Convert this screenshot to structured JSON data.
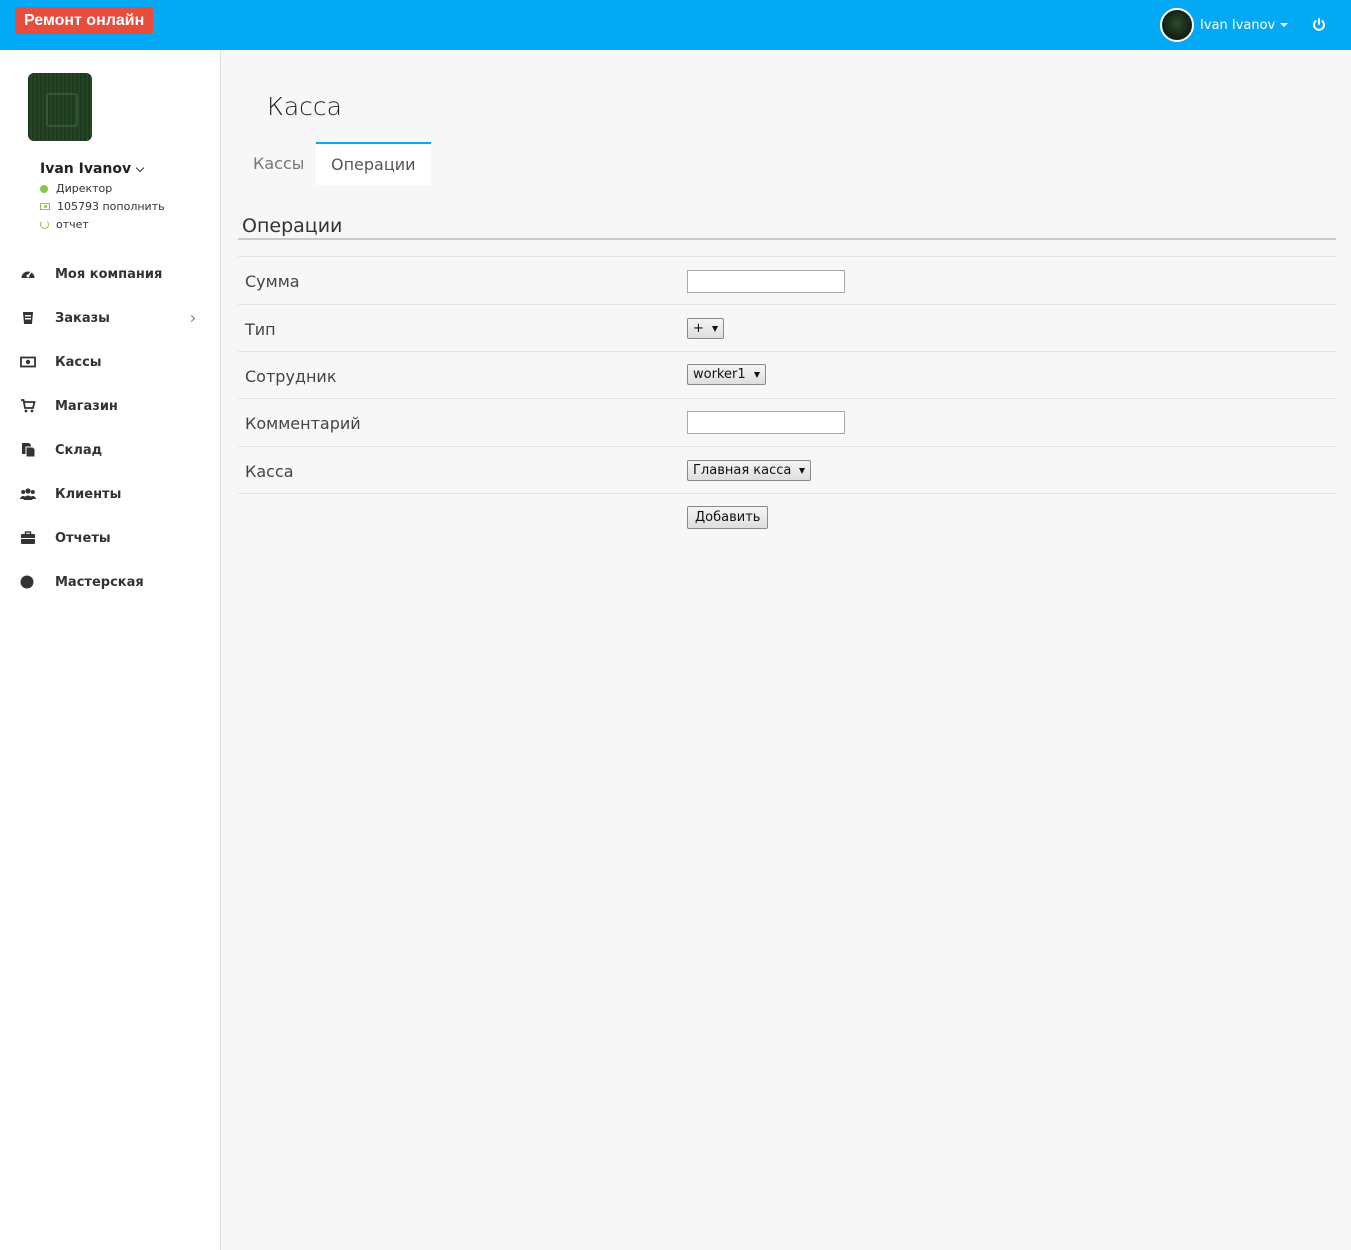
{
  "header": {
    "brand": "Ремонт онлайн",
    "user_name": "Ivan Ivanov",
    "accent_color": "#03a9f4",
    "brand_color": "#e74c3c"
  },
  "sidebar": {
    "user_name": "Ivan Ivanov",
    "role": "Директор",
    "balance": "105793 пополнить",
    "report": "отчет",
    "items": [
      {
        "label": "Моя компания",
        "icon": "dashboard-icon"
      },
      {
        "label": "Заказы",
        "icon": "orders-icon"
      },
      {
        "label": "Кассы",
        "icon": "cash-icon"
      },
      {
        "label": "Магазин",
        "icon": "cart-icon"
      },
      {
        "label": "Склад",
        "icon": "warehouse-icon"
      },
      {
        "label": "Клиенты",
        "icon": "users-icon"
      },
      {
        "label": "Отчеты",
        "icon": "briefcase-icon"
      },
      {
        "label": "Мастерская",
        "icon": "circle-icon"
      }
    ]
  },
  "main": {
    "title": "Касса",
    "tabs": [
      {
        "label": "Кассы",
        "active": false
      },
      {
        "label": "Операции",
        "active": true
      }
    ],
    "section_title": "Операции",
    "form": {
      "sum_label": "Сумма",
      "sum_value": "",
      "type_label": "Тип",
      "type_value": "+",
      "employee_label": "Сотрудник",
      "employee_value": "worker1",
      "comment_label": "Комментарий",
      "comment_value": "",
      "cashbox_label": "Касса",
      "cashbox_value": "Главная касса",
      "submit_label": "Добавить"
    }
  }
}
